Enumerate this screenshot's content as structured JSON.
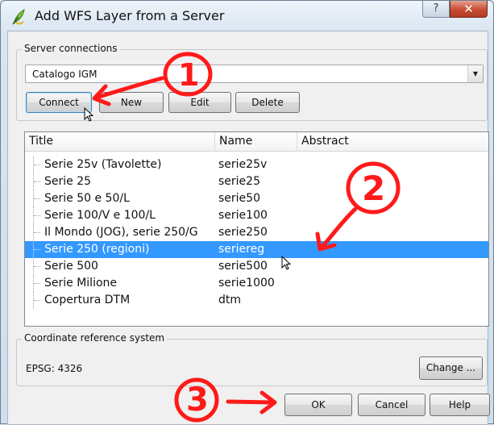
{
  "window": {
    "title": "Add WFS Layer from a Server",
    "help_glyph": "?",
    "close_glyph": "✕"
  },
  "server": {
    "group_title": "Server connections",
    "selected_connection": "Catalogo IGM",
    "buttons": {
      "connect": "Connect",
      "new": "New",
      "edit": "Edit",
      "delete": "Delete"
    }
  },
  "layers": {
    "columns": [
      "Title",
      "Name",
      "Abstract"
    ],
    "rows": [
      {
        "title": "Serie 25v (Tavolette)",
        "name": "serie25v",
        "abstract": ""
      },
      {
        "title": "Serie 25",
        "name": "serie25",
        "abstract": ""
      },
      {
        "title": "Serie 50 e 50/L",
        "name": "serie50",
        "abstract": ""
      },
      {
        "title": "Serie 100/V e 100/L",
        "name": "serie100",
        "abstract": ""
      },
      {
        "title": "Il Mondo (JOG), serie 250/G",
        "name": "serie250",
        "abstract": ""
      },
      {
        "title": "Serie 250 (regioni)",
        "name": "seriereg",
        "abstract": ""
      },
      {
        "title": "Serie 500",
        "name": "serie500",
        "abstract": ""
      },
      {
        "title": "Serie Milione",
        "name": "serie1000",
        "abstract": ""
      },
      {
        "title": "Copertura DTM",
        "name": "dtm",
        "abstract": ""
      }
    ],
    "selected_row": 5
  },
  "crs": {
    "group_title": "Coordinate reference system",
    "value": "EPSG: 4326",
    "change_button": "Change ..."
  },
  "dialog_buttons": {
    "ok": "OK",
    "cancel": "Cancel",
    "help": "Help"
  },
  "annotations": {
    "step1": "1",
    "step2": "2",
    "step3": "3",
    "color": "#ff1a1a"
  },
  "colors": {
    "selection": "#3399ff",
    "title_icon": "#7cc242"
  },
  "icons": {
    "title": "qgis-icon",
    "help": "help-icon",
    "close": "close-icon",
    "dropdown": "chevron-down-icon",
    "cursor": "mouse-cursor-icon"
  }
}
